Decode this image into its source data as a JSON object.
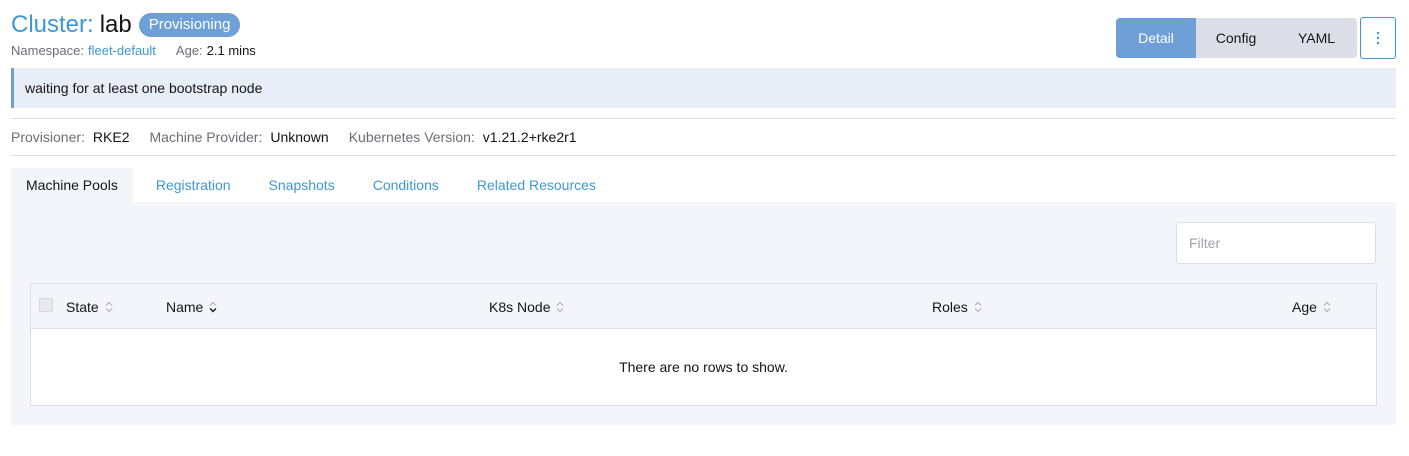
{
  "header": {
    "title_prefix": "Cluster:",
    "title_name": "lab",
    "state_badge": "Provisioning",
    "namespace_label": "Namespace:",
    "namespace_value": "fleet-default",
    "age_label": "Age:",
    "age_value": "2.1 mins"
  },
  "view_switcher": {
    "detail": "Detail",
    "config": "Config",
    "yaml": "YAML",
    "active": "Detail"
  },
  "banner": {
    "message": "waiting for at least one bootstrap node"
  },
  "details": {
    "provisioner_label": "Provisioner:",
    "provisioner_value": "RKE2",
    "machine_provider_label": "Machine Provider:",
    "machine_provider_value": "Unknown",
    "k8s_version_label": "Kubernetes Version:",
    "k8s_version_value": "v1.21.2+rke2r1"
  },
  "tabs": [
    {
      "label": "Machine Pools",
      "active": true
    },
    {
      "label": "Registration",
      "active": false
    },
    {
      "label": "Snapshots",
      "active": false
    },
    {
      "label": "Conditions",
      "active": false
    },
    {
      "label": "Related Resources",
      "active": false
    }
  ],
  "filter": {
    "placeholder": "Filter",
    "value": ""
  },
  "table": {
    "columns": [
      "State",
      "Name",
      "K8s Node",
      "Roles",
      "Age"
    ],
    "sorted_column": "Name",
    "empty_message": "There are no rows to show."
  },
  "colors": {
    "accent": "#3d98d3",
    "badge": "#6e9fd6",
    "panel_bg": "#f4f5fa",
    "banner_bg": "#e8eef7"
  },
  "icons": {
    "menu": "vertical-ellipsis-icon",
    "sort": "sort-arrows-icon",
    "sort_active": "chevron-down-icon"
  }
}
